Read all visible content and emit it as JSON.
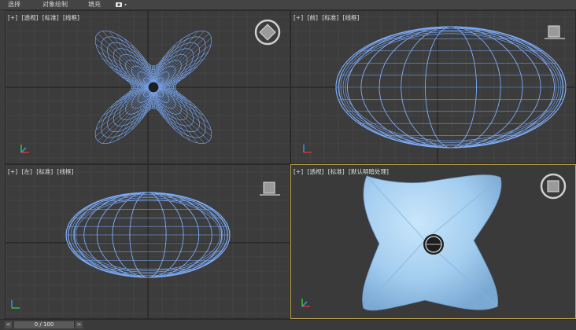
{
  "menu": {
    "items": [
      "选择",
      "对象绘制",
      "填充"
    ],
    "camera_icon": "camera-icon"
  },
  "viewports": {
    "top": {
      "plus": "[+]",
      "view": "[透视]",
      "mode": "[标准]",
      "shading": "[线框]"
    },
    "front": {
      "plus": "[+]",
      "view": "[前]",
      "mode": "[标准]",
      "shading": "[线框]"
    },
    "left": {
      "plus": "[+]",
      "view": "[左]",
      "mode": "[标准]",
      "shading": "[线框]"
    },
    "perspective": {
      "plus": "[+]",
      "view": "[透视]",
      "mode": "[标准]",
      "shading": "[默认明暗处理]"
    }
  },
  "timeline": {
    "frame": "0 / 100",
    "prev": "<",
    "next": ">"
  },
  "colors": {
    "wire": "#7fb0ff",
    "shaded": "#a9d3f5",
    "active_border": "#bba24a",
    "viewport_bg": "#3c3c3c"
  }
}
